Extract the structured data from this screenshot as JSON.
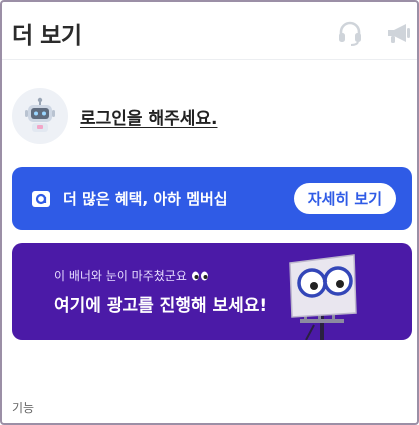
{
  "header": {
    "title": "더 보기",
    "icons": [
      "headset-icon",
      "megaphone-icon"
    ]
  },
  "login": {
    "label": "로그인을 해주세요.",
    "avatar_icon": "robot-avatar-icon"
  },
  "member_banner": {
    "text": "더 많은 혜택, 아하 멤버십",
    "button_label": "자세히 보기",
    "color": "#2f5be6"
  },
  "ad_banner": {
    "subtitle": "이 배너와 눈이 마주쳤군요",
    "title": "여기에 광고를 진행해 보세요!",
    "color": "#4b1aa7"
  },
  "sections": {
    "features_label": "기능"
  }
}
